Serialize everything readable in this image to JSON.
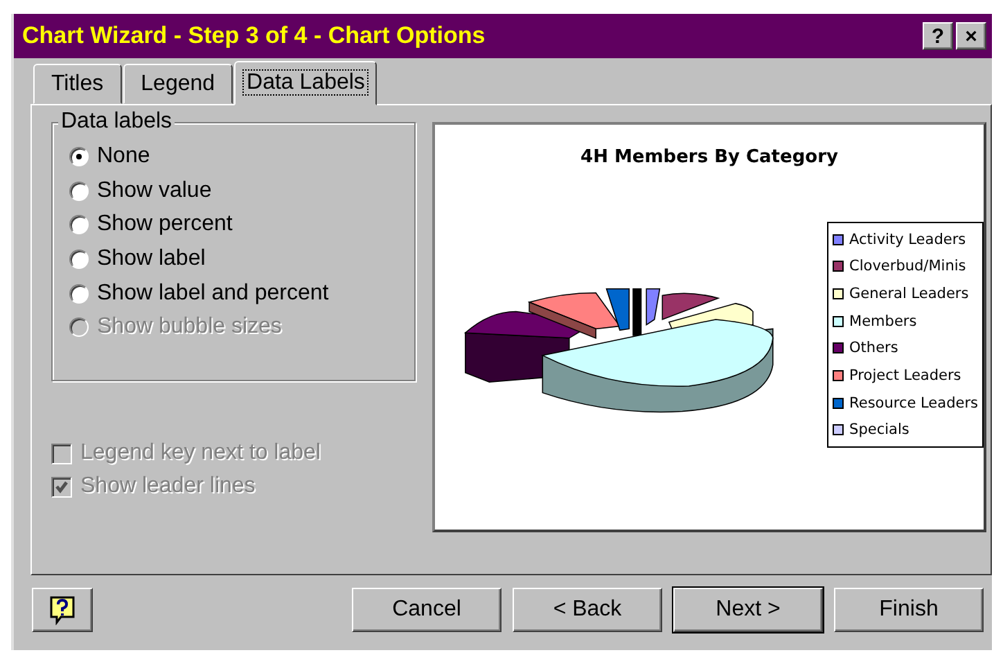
{
  "window": {
    "title": "Chart Wizard - Step 3 of 4 - Chart Options",
    "help_glyph": "?",
    "close_glyph": "×"
  },
  "tabs": [
    {
      "label": "Titles",
      "selected": false
    },
    {
      "label": "Legend",
      "selected": false
    },
    {
      "label": "Data Labels",
      "selected": true
    }
  ],
  "data_labels": {
    "title": "Data labels",
    "options": [
      {
        "label": "None",
        "selected": true,
        "disabled": false
      },
      {
        "label": "Show value",
        "selected": false,
        "disabled": false
      },
      {
        "label": "Show percent",
        "selected": false,
        "disabled": false
      },
      {
        "label": "Show label",
        "selected": false,
        "disabled": false
      },
      {
        "label": "Show label and percent",
        "selected": false,
        "disabled": false
      },
      {
        "label": "Show bubble sizes",
        "selected": false,
        "disabled": true
      }
    ]
  },
  "checkboxes": [
    {
      "label": "Legend key next to label",
      "checked": false,
      "disabled": true
    },
    {
      "label": "Show leader lines",
      "checked": true,
      "disabled": true
    }
  ],
  "preview": {
    "title": "4H Members By Category",
    "legend": [
      {
        "label": "Activity Leaders",
        "color": "#8080ff"
      },
      {
        "label": "Cloverbud/Minis",
        "color": "#993366"
      },
      {
        "label": "General Leaders",
        "color": "#ffffcc"
      },
      {
        "label": "Members",
        "color": "#ccffff"
      },
      {
        "label": "Others",
        "color": "#660066"
      },
      {
        "label": "Project Leaders",
        "color": "#ff8080"
      },
      {
        "label": "Resource Leaders",
        "color": "#0066cc"
      },
      {
        "label": "Specials",
        "color": "#ccccff"
      }
    ]
  },
  "buttons": [
    {
      "label": "Cancel",
      "default": false
    },
    {
      "label": "< Back",
      "default": false
    },
    {
      "label": "Next >",
      "default": true
    },
    {
      "label": "Finish",
      "default": false
    }
  ]
}
